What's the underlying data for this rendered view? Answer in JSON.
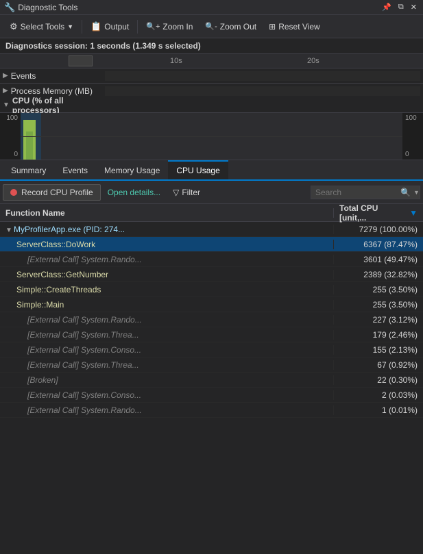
{
  "titleBar": {
    "title": "Diagnostic Tools",
    "pinBtn": "📌",
    "floatBtn": "⧉",
    "closeBtn": "✕"
  },
  "toolbar": {
    "selectToolsLabel": "Select Tools",
    "outputLabel": "Output",
    "zoomInLabel": "Zoom In",
    "zoomOutLabel": "Zoom Out",
    "resetViewLabel": "Reset View"
  },
  "sessionInfo": {
    "text": "Diagnostics session: 1 seconds (1.349 s selected)"
  },
  "timeline": {
    "tick1Label": "10s",
    "tick1Pos": "250",
    "tick2Label": "20s",
    "tick2Pos": "450",
    "eventsLabel": "Events",
    "processMemLabel": "Process Memory (MB)",
    "cpuLabel": "CPU (% of all processors)"
  },
  "cpuChart": {
    "yTopLeft": "100",
    "yBottomLeft": "0",
    "yTopRight": "100",
    "yBottomRight": "0"
  },
  "tabs": {
    "items": [
      {
        "id": "summary",
        "label": "Summary"
      },
      {
        "id": "events",
        "label": "Events"
      },
      {
        "id": "memory",
        "label": "Memory Usage"
      },
      {
        "id": "cpu",
        "label": "CPU Usage",
        "active": true
      }
    ]
  },
  "cpuUsage": {
    "recordBtnLabel": "Record CPU Profile",
    "openDetailsLabel": "Open details...",
    "filterLabel": "Filter",
    "searchPlaceholder": "Search",
    "columns": {
      "functionName": "Function Name",
      "totalCpu": "Total CPU [unit,..."
    },
    "rows": [
      {
        "indent": 0,
        "hasArrow": true,
        "arrowDown": true,
        "functionName": "MyProfilerApp.exe (PID: 274...",
        "functionClass": "func-blue",
        "totalCpu": "7279 (100.00%)",
        "highlighted": false
      },
      {
        "indent": 1,
        "hasArrow": false,
        "functionName": "ServerClass::DoWork",
        "functionClass": "func-yellow",
        "totalCpu": "6367 (87.47%)",
        "highlighted": true
      },
      {
        "indent": 2,
        "hasArrow": false,
        "functionName": "[External Call] System.Rando...",
        "functionClass": "func-gray",
        "totalCpu": "3601 (49.47%)",
        "highlighted": false
      },
      {
        "indent": 1,
        "hasArrow": false,
        "functionName": "ServerClass::GetNumber",
        "functionClass": "func-yellow",
        "totalCpu": "2389 (32.82%)",
        "highlighted": false
      },
      {
        "indent": 1,
        "hasArrow": false,
        "functionName": "Simple::CreateThreads",
        "functionClass": "func-yellow",
        "totalCpu": "255 (3.50%)",
        "highlighted": false
      },
      {
        "indent": 1,
        "hasArrow": false,
        "functionName": "Simple::Main",
        "functionClass": "func-yellow",
        "totalCpu": "255 (3.50%)",
        "highlighted": false
      },
      {
        "indent": 2,
        "hasArrow": false,
        "functionName": "[External Call] System.Rando...",
        "functionClass": "func-gray",
        "totalCpu": "227 (3.12%)",
        "highlighted": false
      },
      {
        "indent": 2,
        "hasArrow": false,
        "functionName": "[External Call] System.Threa...",
        "functionClass": "func-gray",
        "totalCpu": "179 (2.46%)",
        "highlighted": false
      },
      {
        "indent": 2,
        "hasArrow": false,
        "functionName": "[External Call] System.Conso...",
        "functionClass": "func-gray",
        "totalCpu": "155 (2.13%)",
        "highlighted": false
      },
      {
        "indent": 2,
        "hasArrow": false,
        "functionName": "[External Call] System.Threa...",
        "functionClass": "func-gray",
        "totalCpu": "67 (0.92%)",
        "highlighted": false
      },
      {
        "indent": 2,
        "hasArrow": false,
        "functionName": "[Broken]",
        "functionClass": "func-special",
        "totalCpu": "22 (0.30%)",
        "highlighted": false
      },
      {
        "indent": 2,
        "hasArrow": false,
        "functionName": "[External Call] System.Conso...",
        "functionClass": "func-gray",
        "totalCpu": "2 (0.03%)",
        "highlighted": false
      },
      {
        "indent": 2,
        "hasArrow": false,
        "functionName": "[External Call] System.Rando...",
        "functionClass": "func-gray",
        "totalCpu": "1 (0.01%)",
        "highlighted": false
      }
    ]
  }
}
